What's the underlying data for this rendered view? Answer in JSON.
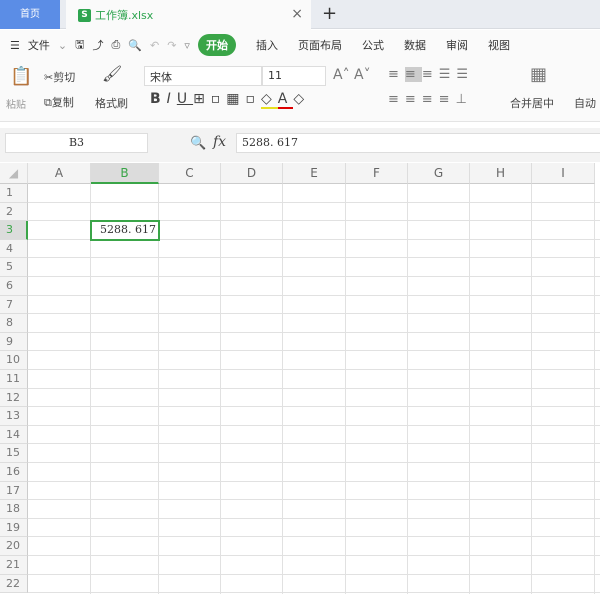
{
  "tabs": {
    "home": "首页",
    "file": "工作簿.xlsx",
    "close": "×",
    "add": "+",
    "logo": "S"
  },
  "menu": {
    "file": "文件",
    "items": [
      "开始",
      "插入",
      "页面布局",
      "公式",
      "数据",
      "审阅",
      "视图"
    ]
  },
  "ribbon": {
    "paste": "粘贴",
    "cut": "剪切",
    "copy": "复制",
    "format_painter": "格式刷",
    "font": "宋体",
    "font_size": "11",
    "merge": "合并居中",
    "autowrap": "自动"
  },
  "formula_bar": {
    "cell_ref": "B3",
    "fx": "fx",
    "value": "5288. 617"
  },
  "sheet": {
    "columns": [
      "A",
      "B",
      "C",
      "D",
      "E",
      "F",
      "G",
      "H",
      "I"
    ],
    "rows": [
      "1",
      "2",
      "3",
      "4",
      "5",
      "6",
      "7",
      "8",
      "9",
      "10",
      "11",
      "12",
      "13",
      "14",
      "15",
      "16",
      "17",
      "18",
      "19",
      "20",
      "21",
      "22"
    ],
    "selected_cell": "B3",
    "cell_B3": "5288. 617"
  },
  "colors": {
    "accent": "#3aa548",
    "home_tab": "#5b8de6"
  }
}
